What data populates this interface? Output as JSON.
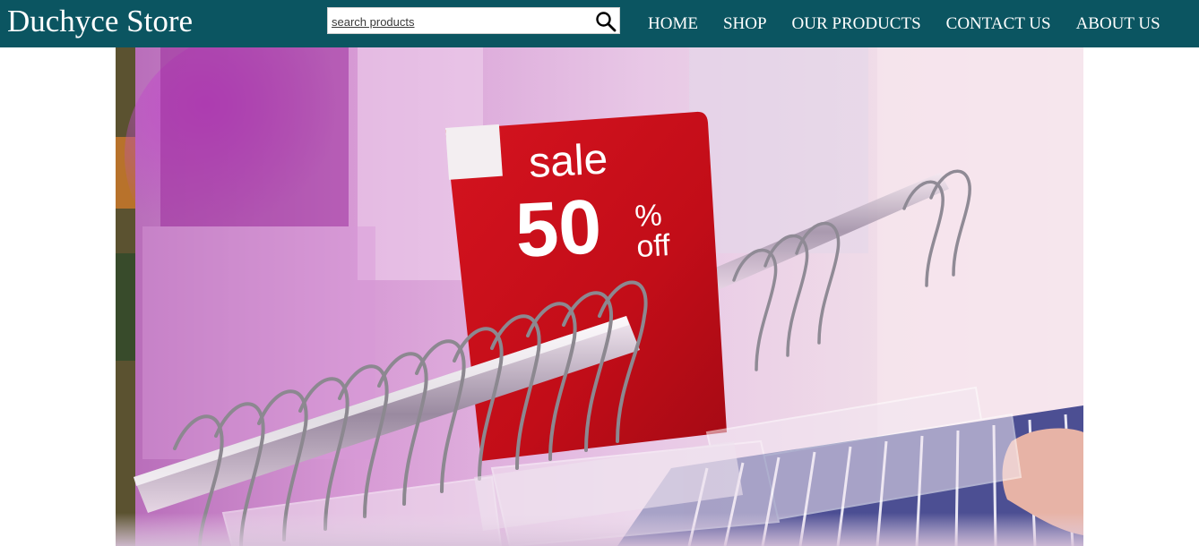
{
  "header": {
    "brand": "Duchyce Store",
    "background_color": "#0b5561"
  },
  "search": {
    "placeholder": "search products",
    "icon": "search-icon"
  },
  "nav": {
    "items": [
      {
        "label": "HOME"
      },
      {
        "label": "SHOP"
      },
      {
        "label": "OUR PRODUCTS"
      },
      {
        "label": "CONTACT US"
      },
      {
        "label": "ABOUT US"
      }
    ]
  },
  "hero": {
    "sign": {
      "word": "sale",
      "amount": "50",
      "percent": "%",
      "suffix": "off",
      "color": "#c8101b"
    }
  }
}
